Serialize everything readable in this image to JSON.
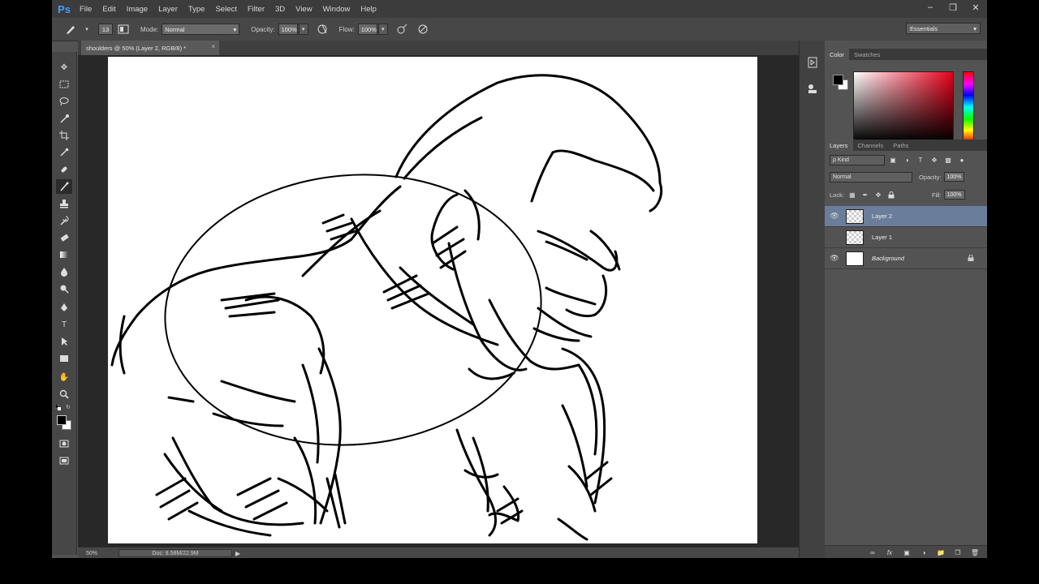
{
  "app": {
    "logo": "Ps"
  },
  "menu": [
    "File",
    "Edit",
    "Image",
    "Layer",
    "Type",
    "Select",
    "Filter",
    "3D",
    "View",
    "Window",
    "Help"
  ],
  "window_controls": [
    "minimize",
    "restore",
    "close"
  ],
  "options_bar": {
    "brush_size": "13",
    "mode_label": "Mode:",
    "mode_value": "Normal",
    "opacity_label": "Opacity:",
    "opacity_value": "100%",
    "flow_label": "Flow:",
    "flow_value": "100%",
    "workspace": "Essentials"
  },
  "document": {
    "tab_title": "shoulders @ 50% (Layer 2, RGB/8) *",
    "close": "×"
  },
  "status": {
    "zoom": "50%",
    "doc_size": "Doc: 8.58M/22.9M",
    "arrow": "▶"
  },
  "panels": {
    "color_tabs": [
      "Color",
      "Swatches"
    ],
    "layer_tabs": [
      "Layers",
      "Channels",
      "Paths"
    ],
    "kind_filter": "ρ Kind",
    "blend_mode": "Normal",
    "opacity_label": "Opacity:",
    "opacity_value": "100%",
    "lock_label": "Lock:",
    "fill_label": "Fill:",
    "fill_value": "100%"
  },
  "layers": [
    {
      "name": "Layer 2",
      "visible": true,
      "selected": true,
      "thumb": "transparent"
    },
    {
      "name": "Layer 1",
      "visible": false,
      "selected": false,
      "thumb": "transparent"
    },
    {
      "name": "Background",
      "visible": true,
      "selected": false,
      "thumb": "white",
      "locked": true
    }
  ],
  "colors": {
    "foreground": "#000000",
    "background": "#ffffff",
    "selection": "#6a7d9a",
    "hue": "#e8001a"
  }
}
